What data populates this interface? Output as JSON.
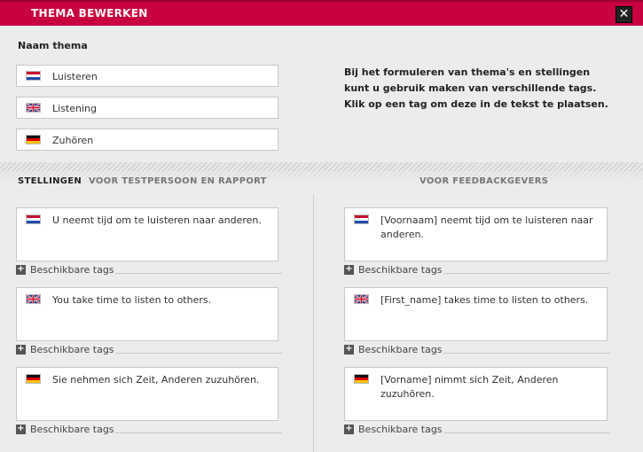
{
  "dialog": {
    "title": "THEMA BEWERKEN",
    "close_label": "✕"
  },
  "naam_label": "Naam thema",
  "theme_names": [
    {
      "lang": "nl",
      "value": "Luisteren"
    },
    {
      "lang": "gb",
      "value": "Listening"
    },
    {
      "lang": "de",
      "value": "Zuhören"
    }
  ],
  "help_text": "Bij het formuleren van thema's en stellingen kunt u gebruik maken van verschillende tags. Klik op een tag om deze in de tekst te plaatsen.",
  "tabs": {
    "stellingen": "STELLINGEN",
    "testpersoon": "VOOR TESTPERSOON EN RAPPORT",
    "feedback": "VOOR FEEDBACKGEVERS"
  },
  "tags_label": "Beschikbare tags",
  "left_statements": [
    {
      "lang": "nl",
      "text": "U neemt tijd om te luisteren naar anderen."
    },
    {
      "lang": "gb",
      "text": "You take time to listen to others."
    },
    {
      "lang": "de",
      "text": "Sie nehmen sich Zeit, Anderen zuzuhören."
    }
  ],
  "right_statements": [
    {
      "lang": "nl",
      "text": "[Voornaam] neemt tijd om te luisteren naar anderen."
    },
    {
      "lang": "gb",
      "text": "[First_name] takes time to listen to others."
    },
    {
      "lang": "de",
      "text": "[Vorname] nimmt sich Zeit, Anderen zuzuhören."
    }
  ],
  "colors": {
    "titlebar": "#c8003f",
    "background": "#ececec"
  }
}
